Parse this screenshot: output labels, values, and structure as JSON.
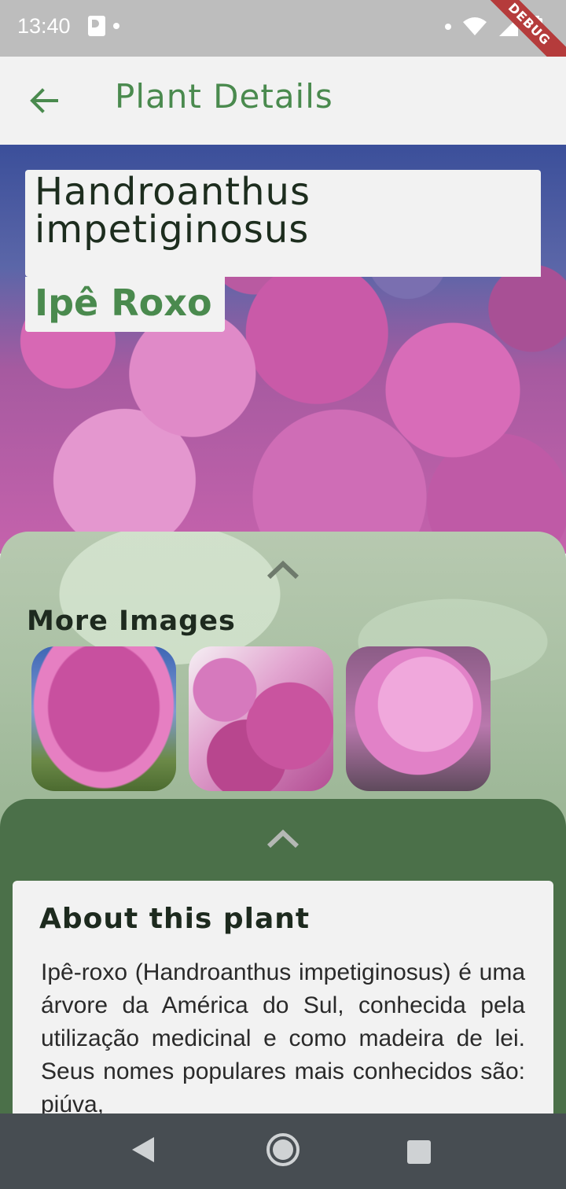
{
  "status_bar": {
    "time": "13:40",
    "debug_label": "DEBUG"
  },
  "app_bar": {
    "title": "Plant Details",
    "accent_color": "#4a8a4e",
    "back_icon": "arrow-left-icon"
  },
  "plant": {
    "scientific_name": "Handroanthus impetiginosus",
    "common_name": "Ipê Roxo"
  },
  "more_images": {
    "title": "More Images",
    "images": [
      {
        "name": "tree-photo"
      },
      {
        "name": "branches-photo"
      },
      {
        "name": "flowers-closeup-photo"
      }
    ]
  },
  "about": {
    "title": "About this plant",
    "text": "Ipê-roxo (Handroanthus impetiginosus) é uma árvore da América do Sul, conhecida pela utilização medicinal e como madeira de lei. Seus nomes populares mais conhecidos são: piúva,"
  },
  "nav_bar": {
    "icons": [
      "back-triangle-icon",
      "home-circle-icon",
      "recents-square-icon"
    ]
  }
}
